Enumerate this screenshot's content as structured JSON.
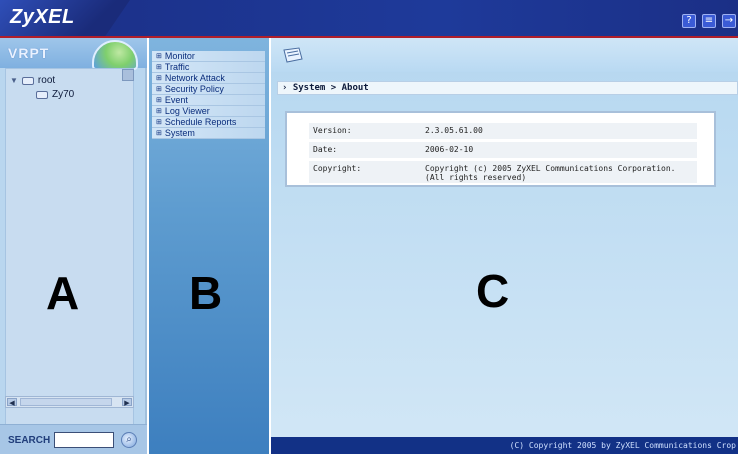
{
  "header": {
    "logo": "ZyXEL",
    "icons": [
      "help-icon",
      "notes-icon",
      "logout-icon"
    ]
  },
  "panel_a": {
    "product_logo": "VRPT",
    "tree": [
      {
        "label": "root",
        "icon": "folder-icon",
        "expanded": true
      },
      {
        "label": "Zy70",
        "icon": "device-icon"
      }
    ],
    "search": {
      "label": "SEARCH",
      "value": ""
    },
    "big_label": "A"
  },
  "panel_b": {
    "menu": [
      "Monitor",
      "Traffic",
      "Network  Attack",
      "Security  Policy",
      "Event",
      "Log  Viewer",
      "Schedule  Reports",
      "System"
    ],
    "big_label": "B"
  },
  "panel_c": {
    "breadcrumb": "System > About",
    "about": {
      "rows": [
        {
          "key": "Version:",
          "value": "2.3.05.61.00"
        },
        {
          "key": "Date:",
          "value": "2006-02-10"
        },
        {
          "key": "Copyright:",
          "value": "Copyright (c) 2005 ZyXEL Communications Corporation. (All rights reserved)"
        }
      ]
    },
    "big_label": "C",
    "footer": "(C) Copyright 2005 by ZyXEL Communications Crop"
  },
  "colors": {
    "header_bg": "#1b2f86",
    "accent_red": "#b01e2a",
    "panel_light": "#b9d6ef",
    "footer_bg": "#123186"
  }
}
